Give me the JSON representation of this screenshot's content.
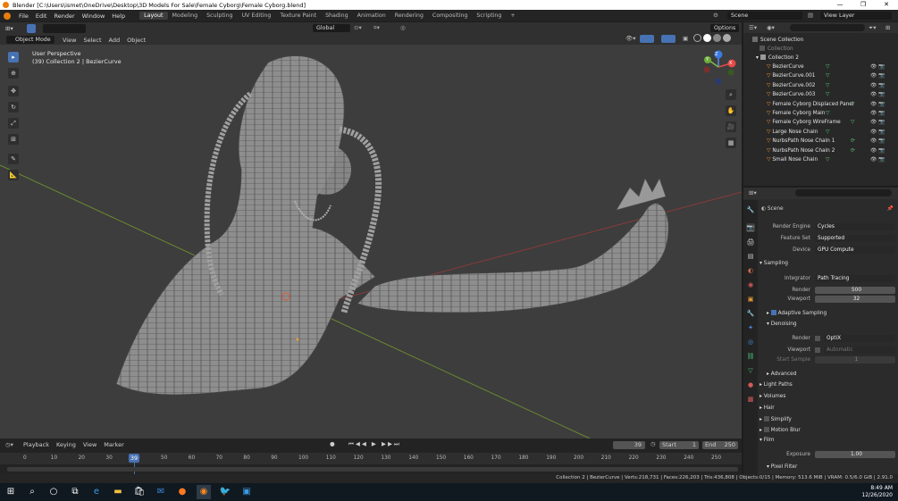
{
  "window": {
    "title": "Blender [C:\\Users\\ismet\\OneDrive\\Desktop\\3D Models For Sale\\Female Cyborg\\Female Cyborg.blend]",
    "minimize": "—",
    "maximize": "❐",
    "close": "✕"
  },
  "menu": [
    "File",
    "Edit",
    "Render",
    "Window",
    "Help"
  ],
  "workspaces": [
    "Layout",
    "Modeling",
    "Sculpting",
    "UV Editing",
    "Texture Paint",
    "Shading",
    "Animation",
    "Rendering",
    "Compositing",
    "Scripting",
    "+"
  ],
  "scene": {
    "name": "Scene",
    "view_layer": "View Layer"
  },
  "viewport": {
    "mode": "Object Mode",
    "menus": [
      "View",
      "Select",
      "Add",
      "Object"
    ],
    "orientation": "Global",
    "options": "Options",
    "info_line1": "User Perspective",
    "info_line2": "(39) Collection 2 | BezierCurve",
    "gizmo": {
      "x": "X",
      "y": "Y",
      "z": "Z"
    }
  },
  "outliner": {
    "root": "Scene Collection",
    "collection": "Collection",
    "collection2": "Collection 2",
    "items": [
      "BezierCurve",
      "BezierCurve.001",
      "BezierCurve.002",
      "BezierCurve.003",
      "Female Cyborg Displaced Panel",
      "Female Cyborg Main",
      "Female Cyborg WireFrame",
      "Large Nose Chain",
      "NurbsPath Nose Chain 1",
      "NurbsPath Nose Chain 2",
      "Small Nose Chain"
    ]
  },
  "properties": {
    "scene_label": "Scene",
    "render_engine_label": "Render Engine",
    "render_engine": "Cycles",
    "feature_set_label": "Feature Set",
    "feature_set": "Supported",
    "device_label": "Device",
    "device": "GPU Compute",
    "sampling": "Sampling",
    "integrator_label": "Integrator",
    "integrator": "Path Tracing",
    "render_label": "Render",
    "render_samples": "500",
    "viewport_label": "Viewport",
    "viewport_samples": "32",
    "adaptive": "Adaptive Sampling",
    "denoising": "Denoising",
    "den_render_label": "Render",
    "den_render": "OptiX",
    "den_viewport_label": "Viewport",
    "den_viewport": "Automatic",
    "start_sample_label": "Start Sample",
    "start_sample": "1",
    "advanced": "Advanced",
    "light_paths": "Light Paths",
    "volumes": "Volumes",
    "hair": "Hair",
    "simplify": "Simplify",
    "motion_blur": "Motion Blur",
    "film": "Film",
    "exposure_label": "Exposure",
    "exposure": "1.00",
    "pixel_filter": "Pixel Filter"
  },
  "timeline": {
    "menus": [
      "Playback",
      "Keying",
      "View",
      "Marker"
    ],
    "current_frame": "39",
    "start_label": "Start",
    "start": "1",
    "end_label": "End",
    "end": "250",
    "ticks": [
      "0",
      "10",
      "20",
      "30",
      "40",
      "50",
      "60",
      "70",
      "80",
      "90",
      "100",
      "110",
      "120",
      "130",
      "140",
      "150",
      "160",
      "170",
      "180",
      "190",
      "200",
      "210",
      "220",
      "230",
      "240",
      "250"
    ]
  },
  "status": {
    "text": "Collection 2 | BezierCurve | Verts:218,731 | Faces:226,203 | Tris:436,808 | Objects:0/15 | Memory: 513.6 MiB | VRAM: 0.5/6.0 GiB | 2.91.0"
  },
  "taskbar": {
    "time": "8:49 AM",
    "date": "12/26/2020"
  }
}
